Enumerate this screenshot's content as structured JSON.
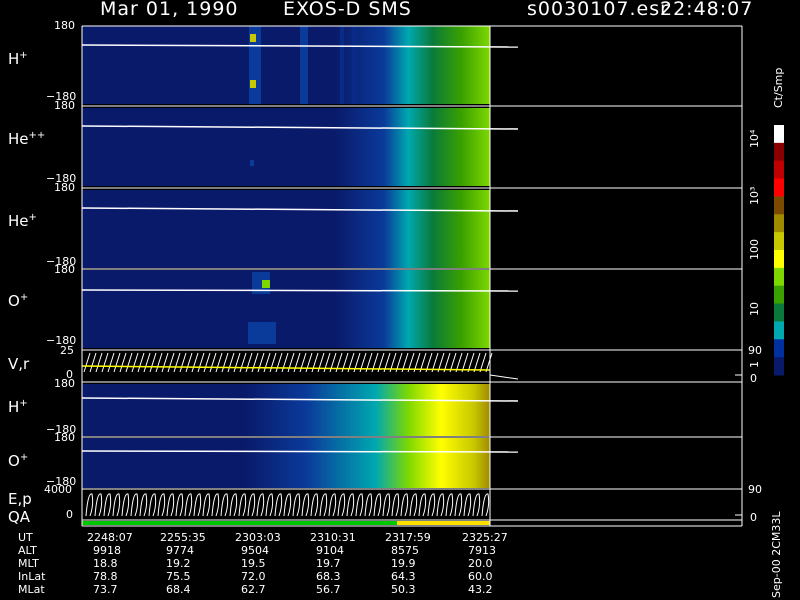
{
  "header": {
    "date": "Mar 01, 1990",
    "instrument": "EXOS-D SMS",
    "file": "s0030107.esr",
    "time": "22:48:07"
  },
  "colorbar": {
    "unit_label": "Ct/Smp",
    "ticks": [
      "10⁴",
      "10³",
      "100",
      "10",
      "1"
    ],
    "colors": [
      "#ffffff",
      "#8a0000",
      "#c00000",
      "#ff0000",
      "#7a4a00",
      "#a08a00",
      "#c8c800",
      "#ffff00",
      "#7ed800",
      "#3aa000",
      "#0a7a3a",
      "#00a8b0",
      "#0030a0",
      "#0a1a6a"
    ]
  },
  "panels": {
    "h_plus": {
      "label": "H",
      "sup": "+",
      "ymax": "180",
      "ymin": "−180"
    },
    "he_pp": {
      "label": "He",
      "sup": "++",
      "ymax": "180",
      "ymin": "−180"
    },
    "he_plus": {
      "label": "He",
      "sup": "+",
      "ymax": "180",
      "ymin": "−180"
    },
    "o_plus": {
      "label": "O",
      "sup": "+",
      "ymax": "180",
      "ymin": "−180"
    },
    "vr": {
      "label": "V,r",
      "ymax": "25",
      "ymin": "0",
      "rmax": "90",
      "rmin": "0"
    },
    "h_plus2": {
      "label": "H",
      "sup": "+",
      "ymax": "180",
      "ymin": "−180"
    },
    "o_plus2": {
      "label": "O",
      "sup": "+",
      "ymax": "180",
      "ymin": "−180"
    },
    "ep": {
      "label": "E,p",
      "ymax": "4000",
      "ymin": "0",
      "rmax": "90",
      "rmin": "0"
    },
    "qa": {
      "label": "QA"
    }
  },
  "footer": {
    "rows": [
      {
        "name": "UT",
        "values": [
          "2248:07",
          "2255:35",
          "2303:03",
          "2310:31",
          "2317:59",
          "2325:27"
        ]
      },
      {
        "name": "ALT",
        "values": [
          "9918",
          "9774",
          "9504",
          "9104",
          "8575",
          "7913"
        ]
      },
      {
        "name": "MLT",
        "values": [
          "18.8",
          "19.2",
          "19.5",
          "19.7",
          "19.9",
          "20.0"
        ]
      },
      {
        "name": "InLat",
        "values": [
          "78.8",
          "75.5",
          "72.0",
          "68.3",
          "64.3",
          "60.0"
        ]
      },
      {
        "name": "MLat",
        "values": [
          "73.7",
          "68.4",
          "62.7",
          "56.7",
          "50.3",
          "43.2"
        ]
      }
    ],
    "version": "Sep-00 2CM33L"
  },
  "chart_data": {
    "type": "heatmap",
    "title": "Mar 01, 1990 EXOS-D SMS",
    "x_tick_labels": [
      "2248:07",
      "2255:35",
      "2303:03",
      "2310:31",
      "2317:59",
      "2325:27"
    ],
    "colorscale_unit": "Ct/Smp",
    "colorscale_ticks": [
      "1",
      "10",
      "100",
      "10³",
      "10⁴"
    ],
    "log_scale": true
  }
}
